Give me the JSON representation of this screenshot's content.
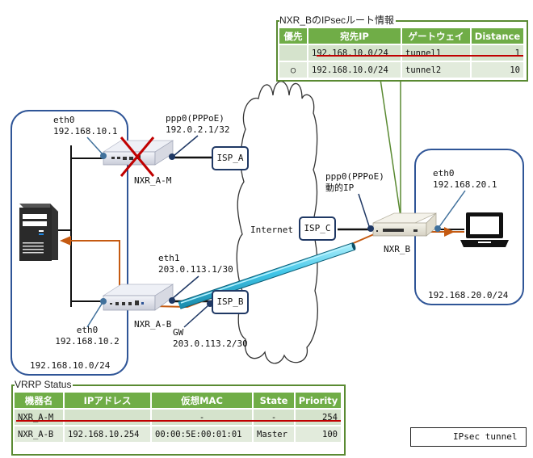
{
  "route_table": {
    "title": "NXR_BのIPsecルート情報",
    "headers": [
      "優先",
      "宛先IP",
      "ゲートウェイ",
      "Distance"
    ],
    "rows": [
      {
        "priority_mark": "",
        "dest": "192.168.10.0/24",
        "gateway": "tunnel1",
        "distance": "1",
        "struck": true
      },
      {
        "priority_mark": "○",
        "dest": "192.168.10.0/24",
        "gateway": "tunnel2",
        "distance": "10",
        "struck": false
      }
    ]
  },
  "vrrp_table": {
    "title": "VRRP Status",
    "headers": [
      "機器名",
      "IPアドレス",
      "仮想MAC",
      "State",
      "Priority"
    ],
    "rows": [
      {
        "name": "NXR_A-M",
        "ip": "",
        "mac": "-",
        "state": "-",
        "priority": "254",
        "struck": true
      },
      {
        "name": "NXR_A-B",
        "ip": "192.168.10.254",
        "mac": "00:00:5E:00:01:01",
        "state": "Master",
        "priority": "100",
        "struck": false
      }
    ]
  },
  "site_a": {
    "network": "192.168.10.0/24",
    "nxr_a_m": {
      "name": "NXR_A-M",
      "status": "failed",
      "eth0_label": "eth0",
      "eth0_ip": "192.168.10.1",
      "ppp0_label": "ppp0(PPPoE)",
      "ppp0_ip": "192.0.2.1/32"
    },
    "nxr_a_b": {
      "name": "NXR_A-B",
      "eth0_label": "eth0",
      "eth0_ip": "192.168.10.2",
      "eth1_label": "eth1",
      "eth1_ip": "203.0.113.1/30",
      "gw_label": "GW",
      "gw_ip": "203.0.113.2/30"
    }
  },
  "internet": {
    "label": "Internet",
    "isp_a": "ISP_A",
    "isp_b": "ISP_B",
    "isp_c": "ISP_C"
  },
  "site_b": {
    "network": "192.168.20.0/24",
    "nxr_b": {
      "name": "NXR_B",
      "ppp0_label": "ppp0(PPPoE)",
      "ppp0_ip": "動的IP",
      "eth0_label": "eth0",
      "eth0_ip": "192.168.20.1"
    }
  },
  "legend": {
    "ipsec_tunnel": "IPsec tunnel"
  },
  "colors": {
    "table_header": "#70ad47",
    "panel_border": "#5a8a32",
    "network_box": "#2f5597",
    "isp_border": "#1f3864",
    "traffic_arrow": "#c55a11",
    "tunnel": "#3ec6e6",
    "failure_mark": "#c00000"
  }
}
